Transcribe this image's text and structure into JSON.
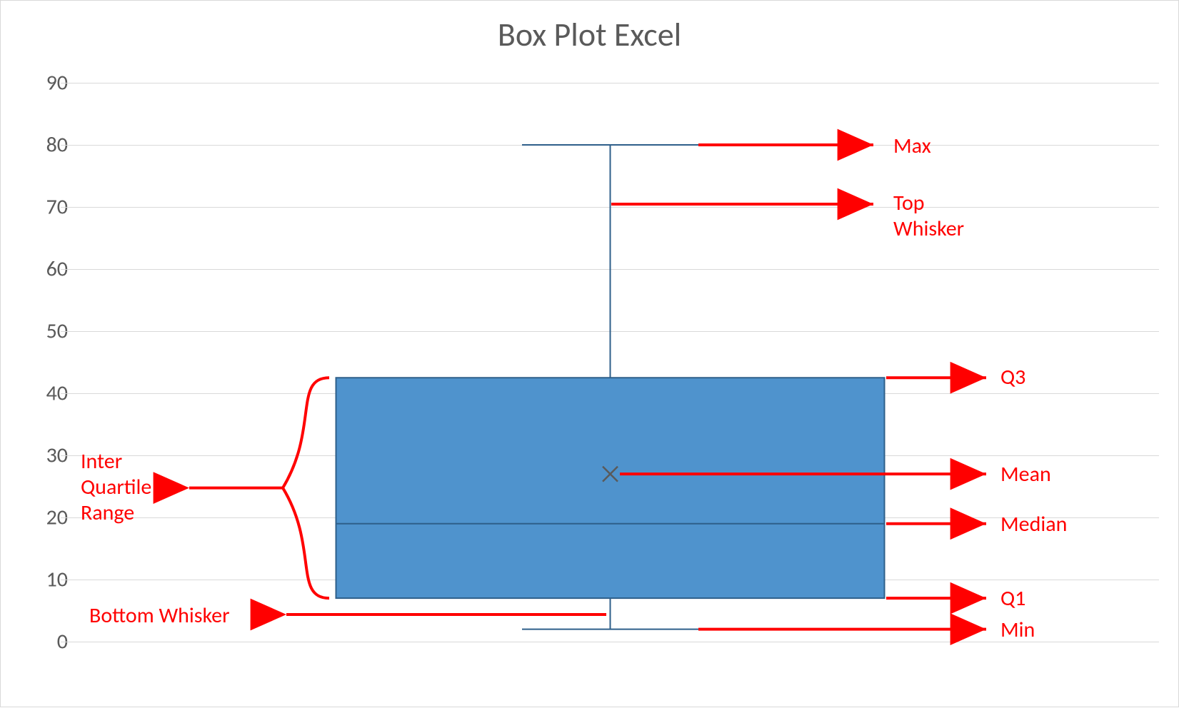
{
  "chart_data": {
    "type": "box",
    "title": "Box Plot Excel",
    "ylabel": "",
    "xlabel": "",
    "ylim": [
      0,
      90
    ],
    "yticks": [
      0,
      10,
      20,
      30,
      40,
      50,
      60,
      70,
      80,
      90
    ],
    "min": 2,
    "q1": 7,
    "median": 19,
    "mean": 27,
    "q3": 42.5,
    "max": 80
  },
  "colors": {
    "box_fill": "#4f93cd",
    "box_stroke": "#2e5f8a",
    "grid": "#d9d9d9",
    "tick_text": "#5a5a5a",
    "annotation": "#ff0000"
  },
  "annotations": {
    "max": "Max",
    "top_whisker": "Top\nWhisker",
    "q3": "Q3",
    "mean": "Mean",
    "median": "Median",
    "q1": "Q1",
    "min": "Min",
    "bottom_whisker": "Bottom Whisker",
    "iqr": "Inter\nQuartile\nRange"
  }
}
